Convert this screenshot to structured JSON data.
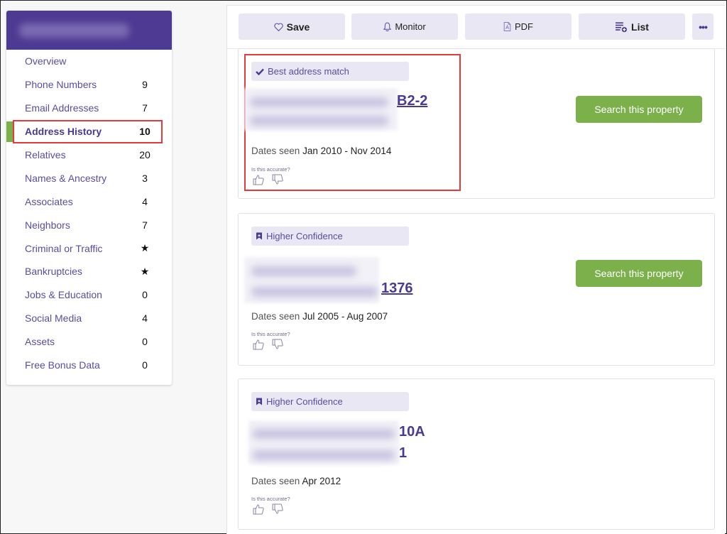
{
  "sidebar": {
    "header_name": "[redacted name]",
    "items": [
      {
        "label": "Overview",
        "count": ""
      },
      {
        "label": "Phone Numbers",
        "count": "9"
      },
      {
        "label": "Email Addresses",
        "count": "7"
      },
      {
        "label": "Address History",
        "count": "10",
        "active": true
      },
      {
        "label": "Relatives",
        "count": "20"
      },
      {
        "label": "Names & Ancestry",
        "count": "3"
      },
      {
        "label": "Associates",
        "count": "4"
      },
      {
        "label": "Neighbors",
        "count": "7"
      },
      {
        "label": "Criminal or Traffic",
        "count": "★"
      },
      {
        "label": "Bankruptcies",
        "count": "★"
      },
      {
        "label": "Jobs & Education",
        "count": "0"
      },
      {
        "label": "Social Media",
        "count": "4"
      },
      {
        "label": "Assets",
        "count": "0"
      },
      {
        "label": "Free Bonus Data",
        "count": "0"
      }
    ],
    "accent_color": "#7cb04b",
    "header_color": "#4e3a92"
  },
  "toolbar": {
    "save_label": "Save",
    "monitor_label": "Monitor",
    "pdf_label": "PDF",
    "list_label": "List",
    "more_label": "•••"
  },
  "addresses": [
    {
      "badge": "Best address match",
      "badge_icon": "check-icon",
      "address_visible_tail": "B2-2",
      "dates_label": "Dates seen",
      "dates_value": "Jan 2010 - Nov 2014",
      "accurate_prompt": "Is this accurate?",
      "action_label": "Search this property"
    },
    {
      "badge": "Higher Confidence",
      "badge_icon": "bookmark-icon",
      "address_visible_tail": "1376",
      "dates_label": "Dates seen",
      "dates_value": "Jul 2005 - Aug 2007",
      "accurate_prompt": "Is this accurate?",
      "action_label": "Search this property"
    },
    {
      "badge": "Higher Confidence",
      "badge_icon": "bookmark-icon",
      "address_visible_tail_line1": "10A",
      "address_visible_tail_line2": "1",
      "dates_label": "Dates seen",
      "dates_value": "Apr 2012",
      "accurate_prompt": "Is this accurate?"
    }
  ],
  "colors": {
    "primary": "#4b3a8f",
    "link": "#5b4c9e",
    "button_green": "#7cb04b",
    "badge_bg": "#e9e7f3",
    "highlight_red": "#e5393d"
  }
}
